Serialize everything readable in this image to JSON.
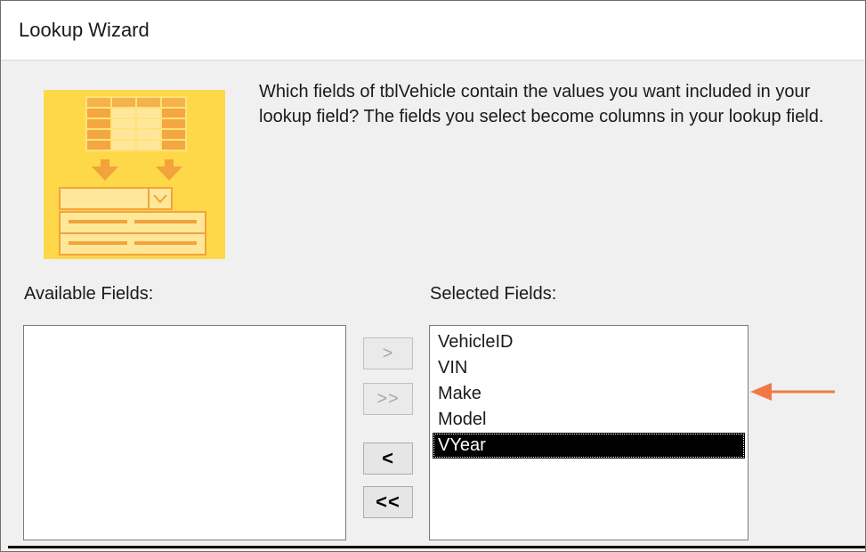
{
  "window": {
    "title": "Lookup Wizard"
  },
  "instructions": "Which fields of tblVehicle contain the values you want included in your lookup field? The fields you select become columns in your lookup field.",
  "available_fields": {
    "label": "Available Fields:",
    "items": []
  },
  "selected_fields": {
    "label": "Selected Fields:",
    "items": [
      "VehicleID",
      "VIN",
      "Make",
      "Model",
      "VYear"
    ],
    "selected_index": 4
  },
  "buttons": {
    "add": {
      "label": ">",
      "enabled": false
    },
    "add_all": {
      "label": ">>",
      "enabled": false
    },
    "remove": {
      "label": "<",
      "enabled": true
    },
    "remove_all": {
      "label": "<<",
      "enabled": true
    }
  },
  "colors": {
    "graphic_background": "#ffd84a",
    "graphic_accent": "#f2a33a",
    "callout_arrow": "#f07a45"
  },
  "icons": {
    "wizard_graphic": "lookup-wizard-graphic-icon",
    "callout": "callout-arrow-icon"
  }
}
